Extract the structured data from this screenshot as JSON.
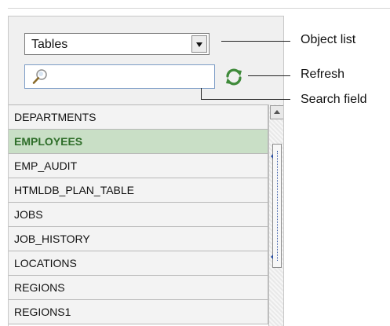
{
  "object_list": {
    "selected": "Tables"
  },
  "search": {
    "value": "",
    "placeholder": ""
  },
  "objects": [
    {
      "label": "DEPARTMENTS",
      "selected": false
    },
    {
      "label": "EMPLOYEES",
      "selected": true
    },
    {
      "label": "EMP_AUDIT",
      "selected": false
    },
    {
      "label": "HTMLDB_PLAN_TABLE",
      "selected": false
    },
    {
      "label": "JOBS",
      "selected": false
    },
    {
      "label": "JOB_HISTORY",
      "selected": false
    },
    {
      "label": "LOCATIONS",
      "selected": false
    },
    {
      "label": "REGIONS",
      "selected": false
    },
    {
      "label": "REGIONS1",
      "selected": false
    }
  ],
  "callouts": {
    "object_list": "Object list",
    "refresh": "Refresh",
    "search_field": "Search field"
  },
  "icons": {
    "search": "magnifier-icon",
    "refresh": "refresh-icon",
    "dropdown": "chevron-down-icon"
  },
  "colors": {
    "selected_row_bg": "#c9dfc6",
    "selected_row_text": "#2f6e2a",
    "refresh_green": "#3f8a3a",
    "search_border": "#7c9cc6"
  }
}
